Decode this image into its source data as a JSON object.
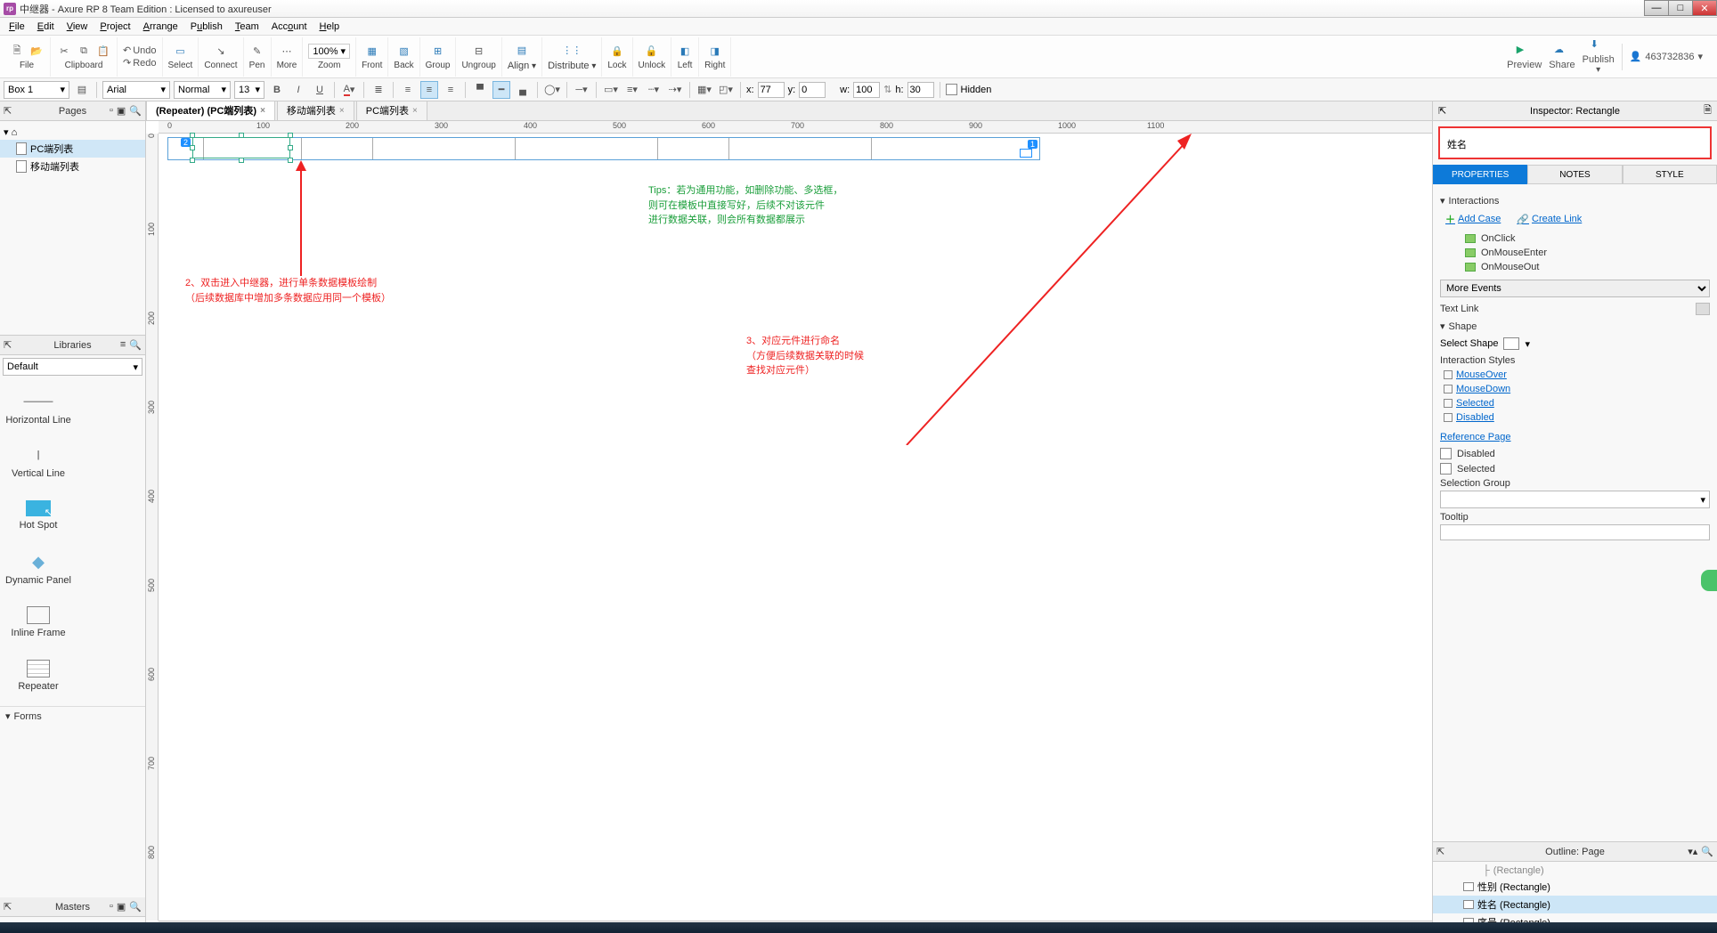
{
  "title": "中继器 - Axure RP 8 Team Edition : Licensed to axureuser",
  "menus": [
    "File",
    "Edit",
    "View",
    "Project",
    "Arrange",
    "Publish",
    "Team",
    "Account",
    "Help"
  ],
  "toolbar": {
    "file": "File",
    "clipboard": "Clipboard",
    "undo": "Undo",
    "redo": "Redo",
    "select": "Select",
    "connect": "Connect",
    "pen": "Pen",
    "more": "More",
    "zoom": "Zoom",
    "zoom_val": "100%",
    "front": "Front",
    "back": "Back",
    "group": "Group",
    "ungroup": "Ungroup",
    "align": "Align",
    "distribute": "Distribute",
    "lock": "Lock",
    "unlock": "Unlock",
    "left": "Left",
    "right": "Right",
    "preview": "Preview",
    "share": "Share",
    "publish": "Publish",
    "user": "463732836"
  },
  "sec": {
    "shape": "Box 1",
    "font": "Arial",
    "weight": "Normal",
    "size": "13",
    "x_label": "x:",
    "x": "77",
    "y_label": "y:",
    "y": "0",
    "w_label": "w:",
    "w": "100",
    "h_label": "h:",
    "h": "30",
    "hidden": "Hidden"
  },
  "left": {
    "pages_title": "Pages",
    "pages": [
      "PC端列表",
      "移动端列表"
    ],
    "libraries_title": "Libraries",
    "lib_default": "Default",
    "lib_items": [
      {
        "name": "Horizontal Line"
      },
      {
        "name": "Vertical Line"
      },
      {
        "name": "Hot Spot"
      },
      {
        "name": "Dynamic Panel"
      },
      {
        "name": "Inline Frame"
      },
      {
        "name": "Repeater"
      }
    ],
    "forms": "Forms",
    "masters_title": "Masters"
  },
  "tabs": [
    {
      "label": "(Repeater) (PC端列表)",
      "active": true
    },
    {
      "label": "移动端列表",
      "active": false
    },
    {
      "label": "PC端列表",
      "active": false
    }
  ],
  "ruler_ticks": [
    "0",
    "100",
    "200",
    "300",
    "400",
    "500",
    "600",
    "700",
    "800",
    "900",
    "1000",
    "1100"
  ],
  "ruler_v": [
    "0",
    "100",
    "200",
    "300",
    "400",
    "500",
    "600",
    "700",
    "800"
  ],
  "annotations": {
    "a2_l1": "2、双击进入中继器，进行单条数据模板绘制",
    "a2_l2": "（后续数据库中增加多条数据应用同一个模板）",
    "tips_l1": "Tips：若为通用功能，如删除功能、多选框，",
    "tips_l2": "则可在模板中直接写好，后续不对该元件",
    "tips_l3": "进行数据关联，则会所有数据都展示",
    "a3_l1": "3、对应元件进行命名",
    "a3_l2": "（方便后续数据关联的时候",
    "a3_l3": "查找对应元件）"
  },
  "inspector": {
    "title": "Inspector: Rectangle",
    "name_value": "姓名",
    "tabs": [
      "PROPERTIES",
      "NOTES",
      "STYLE"
    ],
    "interactions": "Interactions",
    "add_case": "Add Case",
    "create_link": "Create Link",
    "events": [
      "OnClick",
      "OnMouseEnter",
      "OnMouseOut"
    ],
    "more_events": "More Events",
    "text_link": "Text Link",
    "shape": "Shape",
    "select_shape": "Select Shape",
    "interaction_styles": "Interaction Styles",
    "styles": [
      "MouseOver",
      "MouseDown",
      "Selected",
      "Disabled"
    ],
    "reference_page": "Reference Page",
    "disabled": "Disabled",
    "selected": "Selected",
    "selection_group": "Selection Group",
    "tooltip": "Tooltip"
  },
  "outline": {
    "title": "Outline: Page",
    "rows": [
      {
        "label": "性别 (Rectangle)",
        "sel": false,
        "pre": "…"
      },
      {
        "label": "性别 (Rectangle)",
        "sel": false
      },
      {
        "label": "姓名 (Rectangle)",
        "sel": true
      },
      {
        "label": "序号 (Rectangle)",
        "sel": false
      }
    ]
  }
}
